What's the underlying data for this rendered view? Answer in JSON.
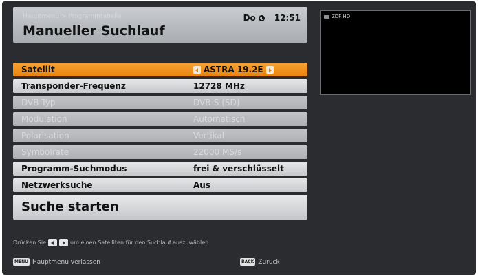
{
  "header": {
    "breadcrumb": "Hauptmenü  >  Programmtabelle",
    "title": "Manueller Suchlauf",
    "day": "Do",
    "time": "12:51"
  },
  "preview": {
    "label": "ZDF HD"
  },
  "menu": {
    "rows": [
      {
        "label": "Satellit",
        "value": "ASTRA 19.2E"
      },
      {
        "label": "Transponder-Frequenz",
        "value": "12728 MHz"
      },
      {
        "label": "DVB Typ",
        "value": "DVB-S (SD)"
      },
      {
        "label": "Modulation",
        "value": "Automatisch"
      },
      {
        "label": "Polarisation",
        "value": "Vertikal"
      },
      {
        "label": "Symbolrate",
        "value": "22000 MS/s"
      },
      {
        "label": "Programm-Suchmodus",
        "value": "frei & verschlüsselt"
      },
      {
        "label": "Netzwerksuche",
        "value": "Aus"
      }
    ],
    "start_label": "Suche starten"
  },
  "hint": {
    "prefix": "Drücken Sie",
    "suffix": "um einen Satelliten für den Suchlauf auszuwählen"
  },
  "footer": {
    "menu_key": "MENU",
    "menu_label": "Hauptmenü verlassen",
    "back_key": "BACK",
    "back_label": "Zurück"
  }
}
